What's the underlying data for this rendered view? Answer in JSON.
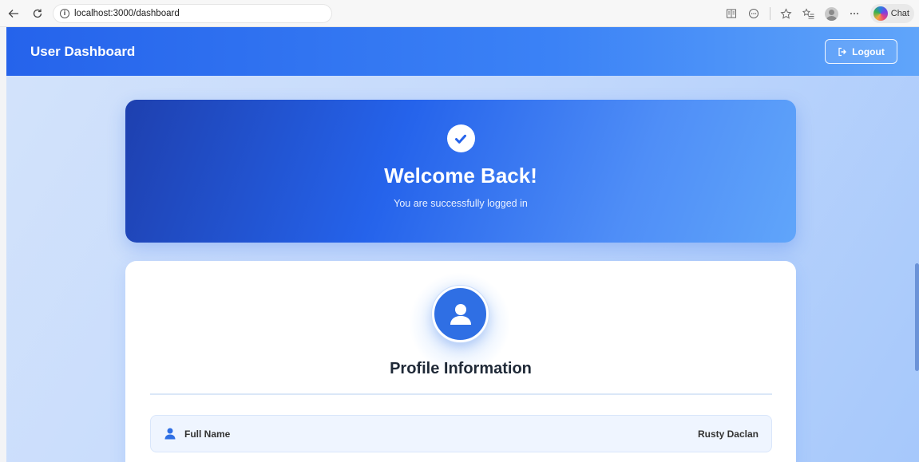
{
  "browser": {
    "url": "localhost:3000/dashboard",
    "chat_label": "Chat"
  },
  "header": {
    "title": "User Dashboard",
    "logout_label": "Logout"
  },
  "welcome": {
    "title": "Welcome Back!",
    "subtitle": "You are successfully logged in"
  },
  "profile": {
    "title": "Profile Information",
    "rows": [
      {
        "icon": "user-icon",
        "label": "Full Name",
        "value": "Rusty Daclan"
      }
    ]
  },
  "colors": {
    "primary": "#2563eb",
    "header_gradient_end": "#60a5fa",
    "avatar_bg": "#2f6fe4",
    "row_bg": "#eff5ff"
  }
}
